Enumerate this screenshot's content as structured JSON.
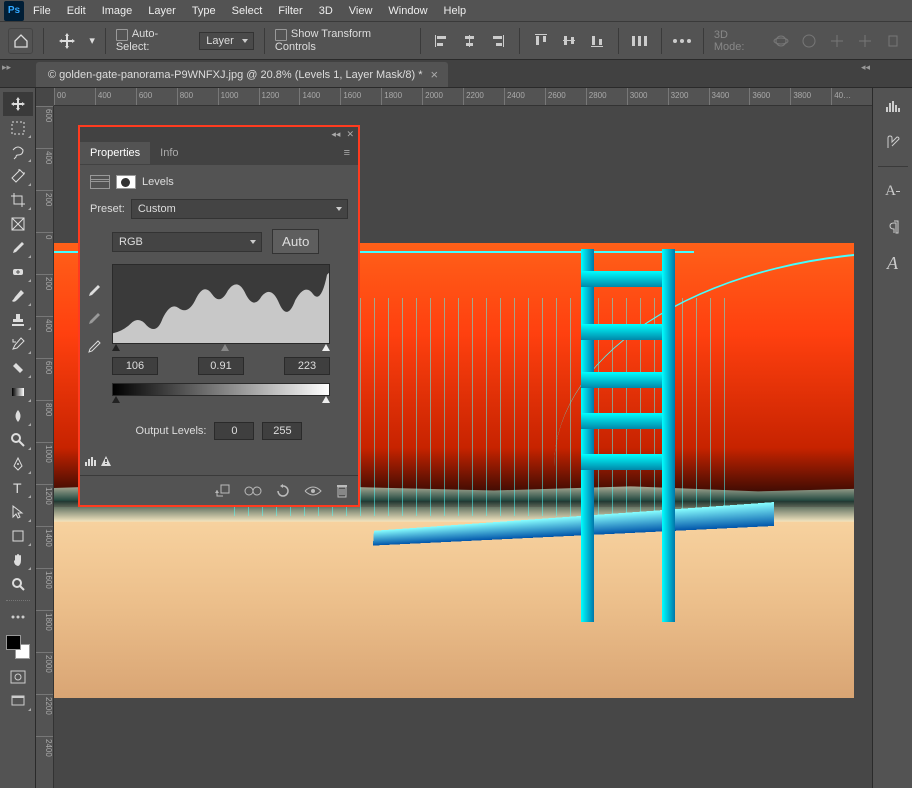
{
  "menubar": {
    "items": [
      "File",
      "Edit",
      "Image",
      "Layer",
      "Type",
      "Select",
      "Filter",
      "3D",
      "View",
      "Window",
      "Help"
    ]
  },
  "optionsbar": {
    "auto_select_label": "Auto-Select:",
    "auto_select_target": "Layer",
    "show_transform_label": "Show Transform Controls",
    "mode3d_label": "3D Mode:"
  },
  "document": {
    "tab_title": "© golden-gate-panorama-P9WNFXJ.jpg @ 20.8% (Levels 1, Layer Mask/8) *"
  },
  "ruler_h": [
    "00",
    "400",
    "600",
    "800",
    "1000",
    "1200",
    "1400",
    "1600",
    "1800",
    "2000",
    "2200",
    "2400",
    "2600",
    "2800",
    "3000",
    "3200",
    "3400",
    "3600",
    "3800",
    "40…"
  ],
  "ruler_v": [
    "600",
    "400",
    "200",
    "0",
    "200",
    "400",
    "600",
    "800",
    "1000",
    "1200",
    "1400",
    "1600",
    "1800",
    "2000",
    "2200",
    "2400"
  ],
  "properties": {
    "tabs": {
      "properties": "Properties",
      "info": "Info"
    },
    "adjustment_name": "Levels",
    "preset_label": "Preset:",
    "preset_value": "Custom",
    "channel_value": "RGB",
    "auto_label": "Auto",
    "input_black": "106",
    "input_gamma": "0.91",
    "input_white": "223",
    "output_label": "Output Levels:",
    "output_black": "0",
    "output_white": "255"
  },
  "right_panel_icons": [
    "histogram",
    "swatches",
    "character",
    "paragraph",
    "glyphs"
  ]
}
